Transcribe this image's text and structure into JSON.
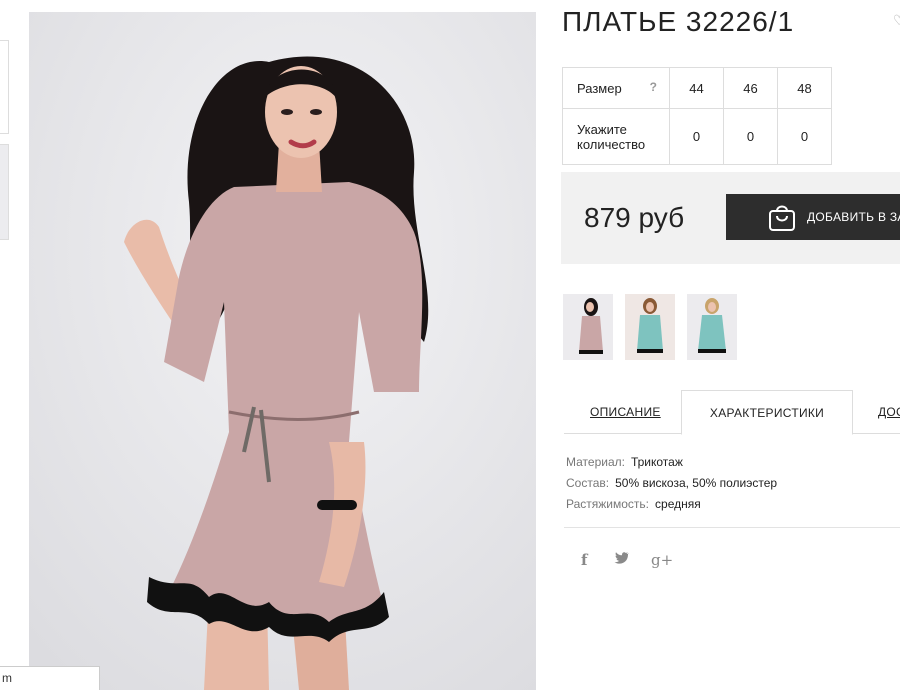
{
  "product": {
    "title": "ПЛАТЬЕ 32226/1"
  },
  "size_table": {
    "size_label": "Размер",
    "help_mark": "?",
    "sizes": [
      "44",
      "46",
      "48"
    ],
    "qty_label_line1": "Укажите",
    "qty_label_line2": "количество",
    "quantities": [
      "0",
      "0",
      "0"
    ]
  },
  "buy": {
    "price": "879 руб",
    "cart_button": "ДОБАВИТЬ В ЗАКАЗ",
    "button_color": "#2d2d2d"
  },
  "thumbnails": [
    {
      "color": "pink"
    },
    {
      "color": "mint"
    },
    {
      "color": "mint"
    }
  ],
  "tabs": {
    "description": "ОПИСАНИЕ",
    "characteristics": "ХАРАКТЕРИСТИКИ",
    "delivery": "ДОСТАВКА"
  },
  "specs": [
    {
      "key": "Материал:",
      "value": "Трикотаж"
    },
    {
      "key": "Состав:",
      "value": "50% вискоза, 50% полиэстер"
    },
    {
      "key": "Растяжимость:",
      "value": "средняя"
    }
  ],
  "social": {
    "facebook": "f",
    "twitter": "🐦",
    "google_plus": "g+"
  },
  "status_bar": {
    "text": "m"
  },
  "colors": {
    "dress_pink": "#c9a6a6",
    "dress_mint": "#7ec3bf",
    "lace": "#111111",
    "hair": "#1a1414"
  }
}
